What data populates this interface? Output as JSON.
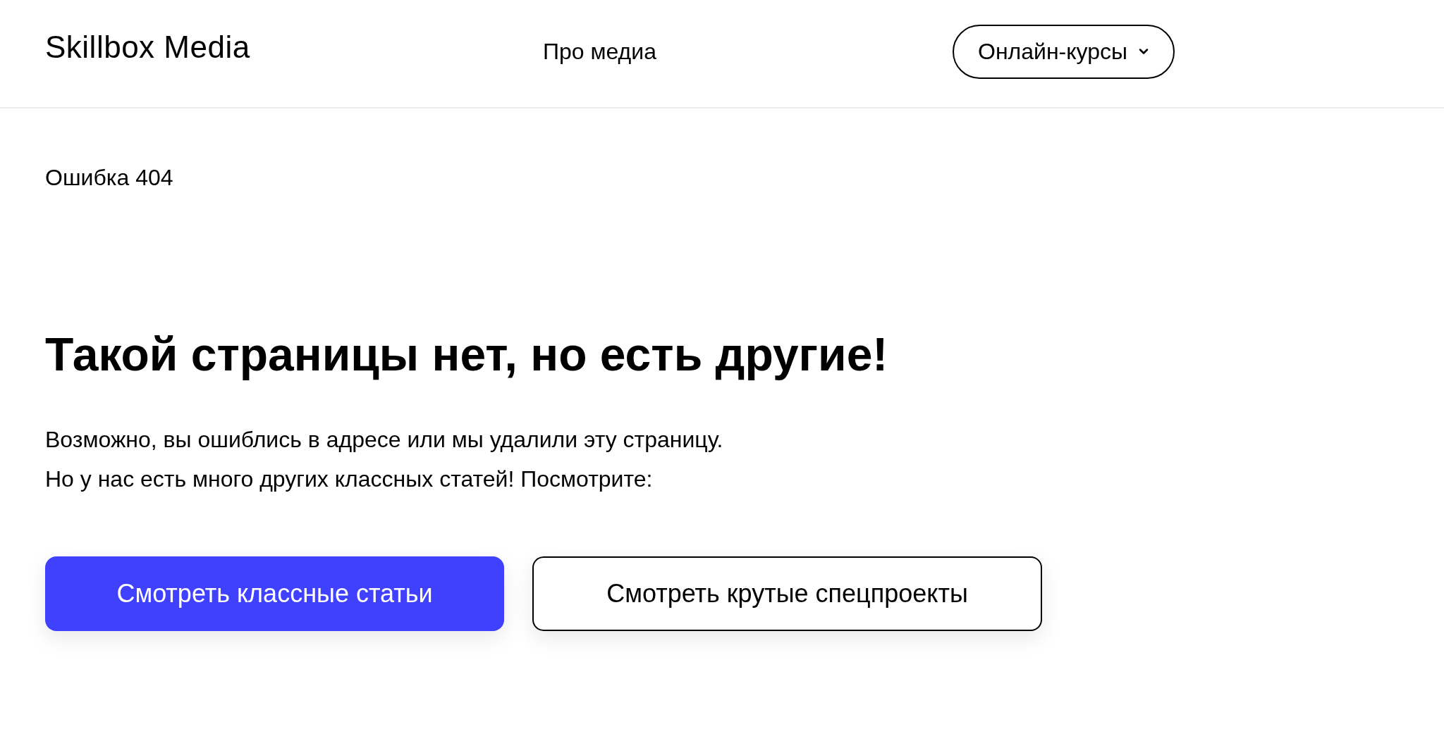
{
  "header": {
    "logo": "Skillbox Media",
    "nav": [
      {
        "label": "Про медиа"
      }
    ],
    "courses_button": {
      "label": "Онлайн-курсы"
    }
  },
  "breadcrumb": "Ошибка 404",
  "heading": "Такой страницы нет, но есть другие!",
  "paragraphs": [
    "Возможно, вы ошиблись в адресе или мы удалили эту страницу.",
    "Но у нас есть много других классных статей! Посмотрите:"
  ],
  "buttons": [
    {
      "label": "Смотреть классные статьи",
      "kind": "primary"
    },
    {
      "label": "Смотреть крутые спецпроекты",
      "kind": "secondary"
    }
  ]
}
